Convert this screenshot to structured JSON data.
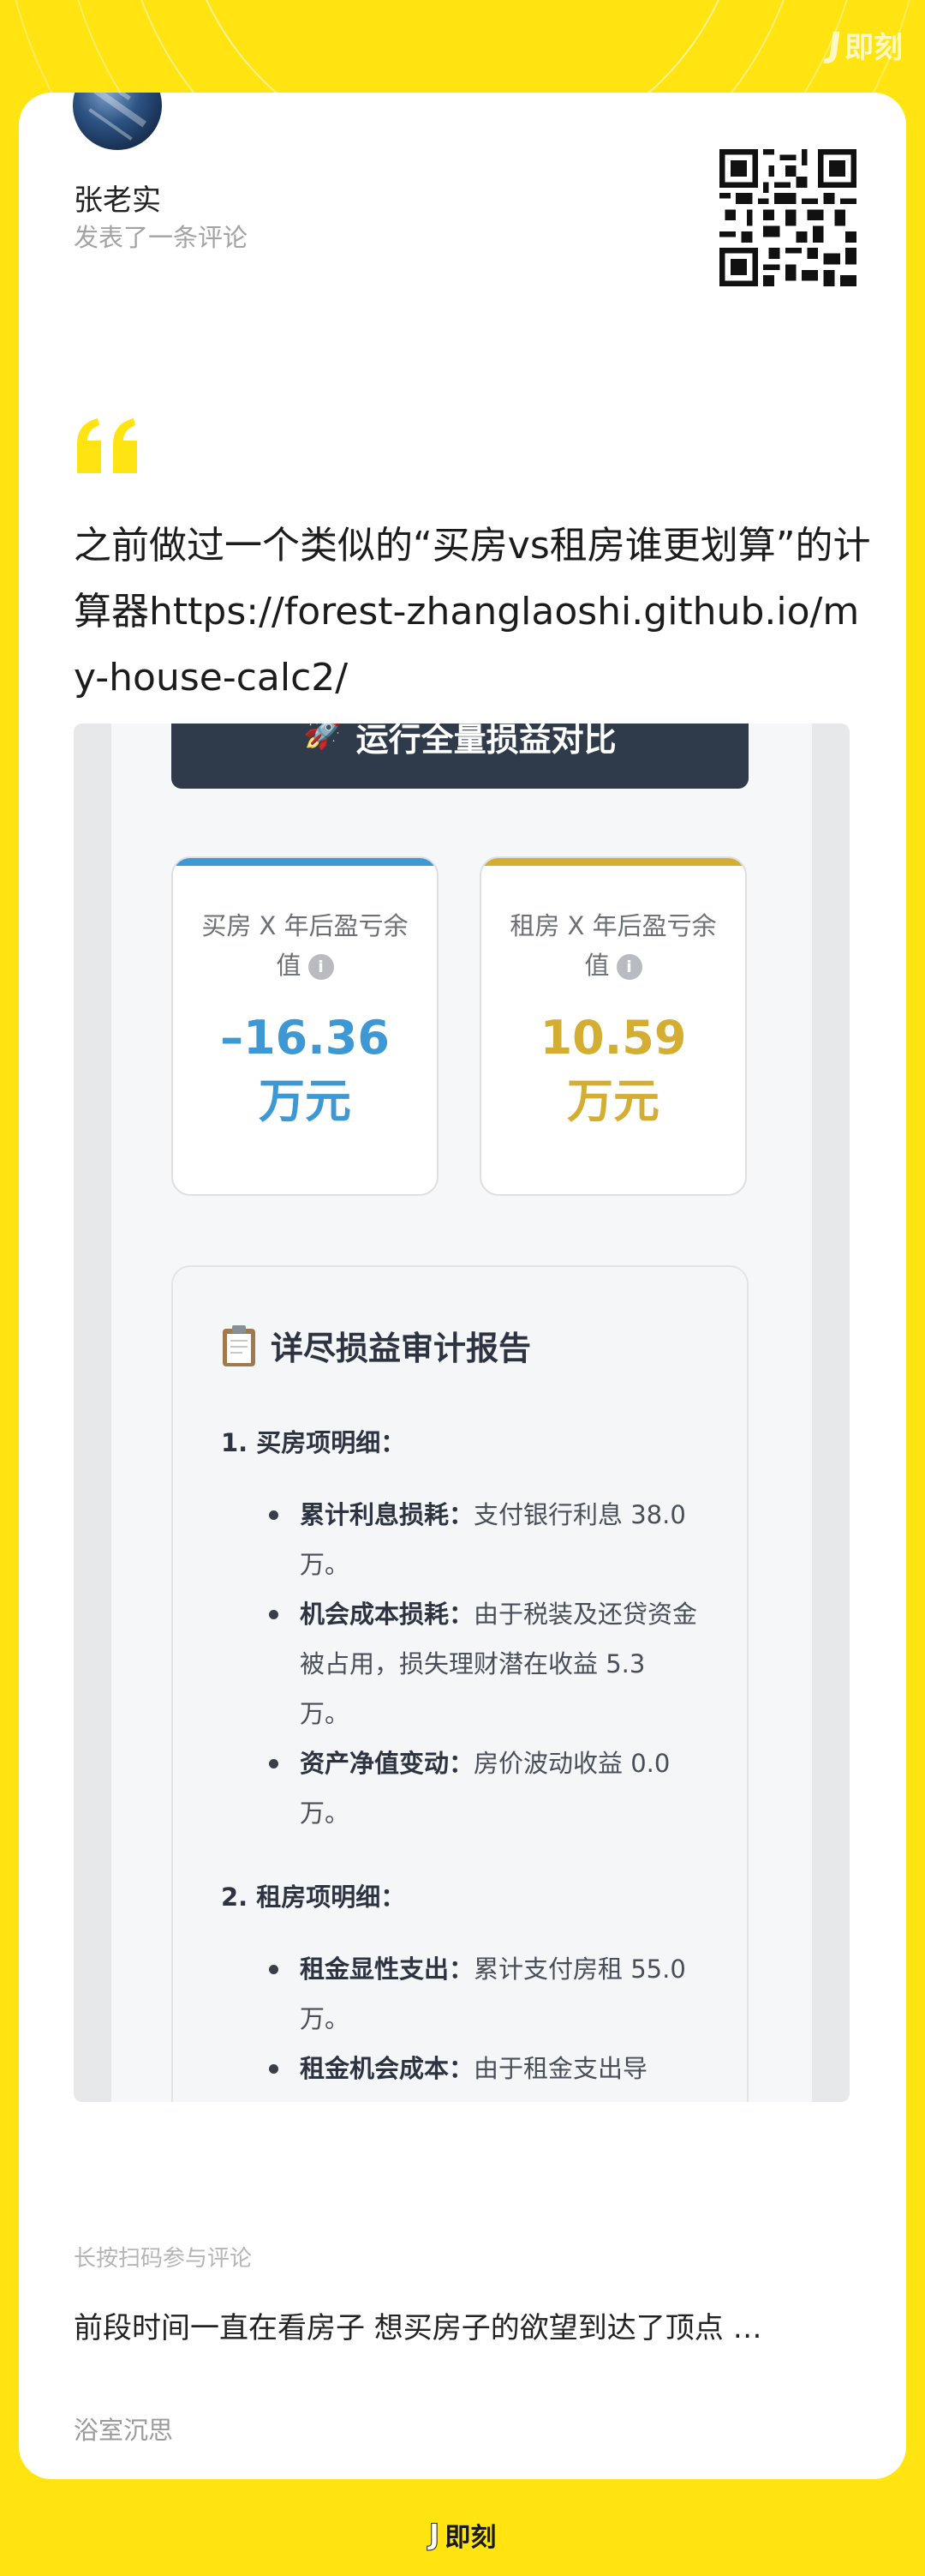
{
  "brand": {
    "name": "即刻",
    "mark": "J"
  },
  "author": {
    "name": "张老实",
    "action": "发表了一条评论"
  },
  "comment": {
    "text": "之前做过一个类似的“买房vs租房谁更划算”的计算器https://forest-zhanglaoshi.github.io/my-house-calc2/"
  },
  "screenshot": {
    "run_button": "运行全量损益对比",
    "run_icon": "rocket-icon",
    "metrics": [
      {
        "label": "买房 X 年后盈亏余值",
        "info": "i",
        "value": "–16.36",
        "unit": "万元",
        "color": "#3e98d3"
      },
      {
        "label": "租房 X 年后盈亏余值",
        "info": "i",
        "value": "10.59",
        "unit": "万元",
        "color": "#d3ae32"
      }
    ],
    "report": {
      "title": "详尽损益审计报告",
      "icon": "clipboard-icon",
      "buy_section": "1. 买房项明细：",
      "buy_items": [
        {
          "key": "累计利息损耗：",
          "text": "支付银行利息 38.0 万。"
        },
        {
          "key": "机会成本损耗：",
          "text": "由于税装及还贷资金被占用，损失理财潜在收益 5.3 万。"
        },
        {
          "key": "资产净值变动：",
          "text": "房价波动收益 0.0 万。"
        }
      ],
      "rent_section": "2. 租房项明细：",
      "rent_items": [
        {
          "key": "租金显性支出：",
          "text": "累计支付房租 55.0 万。"
        },
        {
          "key": "租金机会成本：",
          "text": "由于租金支出导"
        }
      ]
    }
  },
  "footer": {
    "hint": "长按扫码参与评论",
    "post_title": "前段时间一直在看房子 想买房子的欲望到达了顶点 …",
    "post_author": "浴室沉思"
  },
  "colors": {
    "background": "#FFE411",
    "card": "#ffffff"
  }
}
